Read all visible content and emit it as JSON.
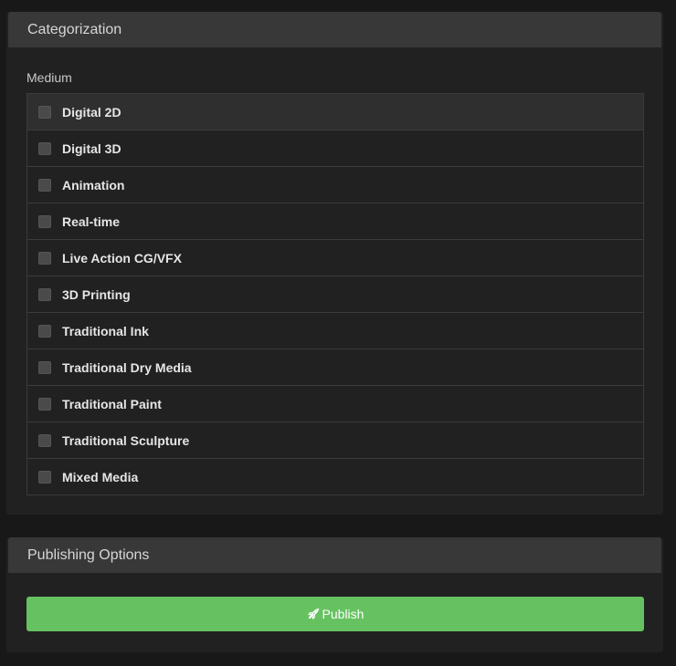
{
  "categorization": {
    "header": "Categorization",
    "medium_label": "Medium",
    "options": [
      {
        "label": "Digital 2D",
        "checked": false
      },
      {
        "label": "Digital 3D",
        "checked": false
      },
      {
        "label": "Animation",
        "checked": false
      },
      {
        "label": "Real-time",
        "checked": false
      },
      {
        "label": "Live Action CG/VFX",
        "checked": false
      },
      {
        "label": "3D Printing",
        "checked": false
      },
      {
        "label": "Traditional Ink",
        "checked": false
      },
      {
        "label": "Traditional Dry Media",
        "checked": false
      },
      {
        "label": "Traditional Paint",
        "checked": false
      },
      {
        "label": "Traditional Sculpture",
        "checked": false
      },
      {
        "label": "Mixed Media",
        "checked": false
      }
    ]
  },
  "publishing": {
    "header": "Publishing Options",
    "publish_label": "Publish",
    "publish_icon": "rocket-icon",
    "accent_color": "#66c261"
  }
}
